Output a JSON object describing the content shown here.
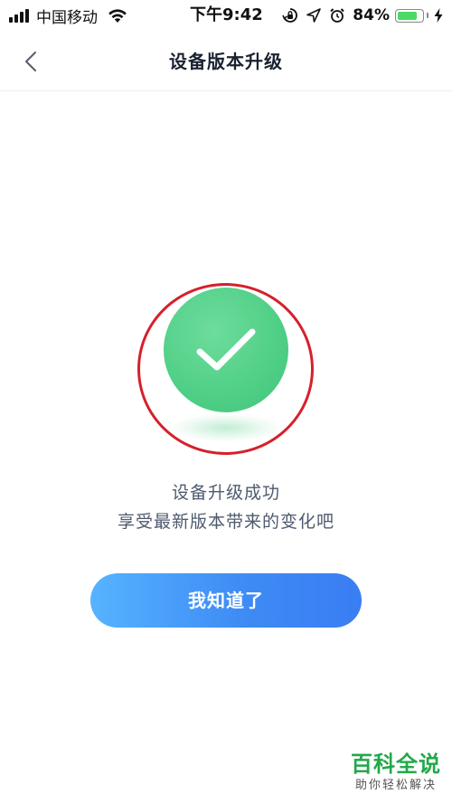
{
  "status_bar": {
    "carrier": "中国移动",
    "time": "下午9:42",
    "battery_percent_label": "84%",
    "battery_level": 0.84,
    "battery_color": "#4cd964",
    "icons": [
      "signal-icon",
      "wifi-icon",
      "rotation-lock-icon",
      "location-icon",
      "alarm-icon",
      "battery-icon",
      "charging-icon"
    ]
  },
  "nav": {
    "back_icon": "chevron-left-icon",
    "title": "设备版本升级"
  },
  "result": {
    "icon": "checkmark-icon",
    "icon_color": "#4fcf86",
    "annotation_color": "#d6202c",
    "message_line1": "设备升级成功",
    "message_line2": "享受最新版本带来的变化吧"
  },
  "button": {
    "label": "我知道了",
    "gradient": [
      "#57b3ff",
      "#3a7df3"
    ]
  },
  "watermark": {
    "title": "百科全说",
    "subtitle": "助你轻松解决",
    "color": "#22a84a"
  }
}
